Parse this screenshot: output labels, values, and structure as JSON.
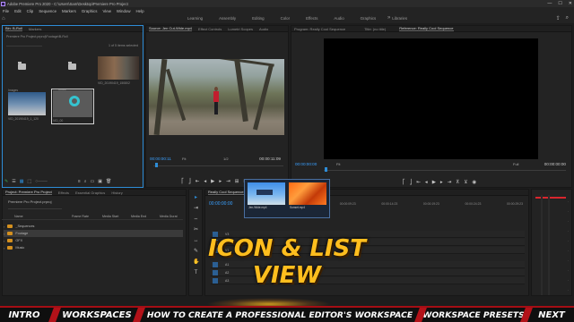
{
  "window": {
    "title": "Adobe Premiere Pro 2020 - C:\\Users\\Sam\\Desktop\\Premiere Pro Project",
    "controls": [
      "—",
      "☐",
      "✕"
    ]
  },
  "menubar": [
    "File",
    "Edit",
    "Clip",
    "Sequence",
    "Markers",
    "Graphics",
    "View",
    "Window",
    "Help"
  ],
  "workspaces": {
    "tabs": [
      "Learning",
      "Assembly",
      "Editing",
      "Color",
      "Effects",
      "Audio",
      "Graphics",
      "Libraries"
    ],
    "more": "»"
  },
  "bin_panel": {
    "tabs": [
      "Bin: B-Roll",
      "Markers"
    ],
    "path": "Premiere Pro Project.prproj\\Footage\\B-Roll",
    "selection": "1 of 5 items selected",
    "search_placeholder": "",
    "items": [
      {
        "caption": "Images",
        "kind": "folder"
      },
      {
        "caption": "Audio",
        "kind": "folder"
      },
      {
        "caption": "VID_20190419_150802",
        "kind": "video"
      },
      {
        "caption": "VID_20190419_1_120",
        "kind": "video"
      },
      {
        "caption": "VID_00",
        "kind": "video"
      }
    ]
  },
  "source_monitor": {
    "tabs": [
      "Source: Jen Cut-Wide.mp4",
      "Effect Controls",
      "Lumetri Scopes",
      "Audio"
    ],
    "timecode_in": "00:00:00:11",
    "timecode_out": "00:00:11:09",
    "fit": "Fit",
    "resolution": "1/2"
  },
  "program_monitor": {
    "tabs": [
      "Program: Really Cool Sequence",
      "Title: (no title)",
      "Reference: Really Cool Sequence"
    ],
    "timecode_in": "00:00:00:00",
    "timecode_out": "00:00:00:00",
    "fit": "Fit",
    "resolution": "Full"
  },
  "project_panel": {
    "tabs": [
      "Project: Premiere Pro Project",
      "Effects",
      "Essential Graphics",
      "History"
    ],
    "project_name": "Premiere Pro Project.prproj",
    "columns": [
      "Name",
      "Frame Rate",
      "Media Start",
      "Media End",
      "Media Durat"
    ],
    "rows": [
      {
        "name": "_Sequences",
        "highlight": false
      },
      {
        "name": "Footage",
        "highlight": true
      },
      {
        "name": "GFX",
        "highlight": false
      },
      {
        "name": "Music",
        "highlight": false
      }
    ]
  },
  "tools": [
    "▸",
    "⇥",
    "⇔",
    "✂",
    "↔",
    "✎",
    "✋",
    "T"
  ],
  "timeline": {
    "tabs": [
      "Really Cool Sequence"
    ],
    "timecode": "00:00:00:00",
    "ruler": [
      "00:00",
      "00:00:04:23",
      "00:00:09:23",
      "00:00:14:23",
      "00:00:19:23",
      "00:00:24:23",
      "00:00:29:23"
    ],
    "tracks": [
      "V3",
      "V2",
      "V1",
      "A1",
      "A2",
      "A3"
    ],
    "clips": [
      {
        "caption": "Jen-Wide.mp4"
      },
      {
        "caption": "Sunset.mp4"
      }
    ]
  },
  "overlay_title": {
    "line1": "ICON & LIST",
    "line2": "VIEW"
  },
  "chapters": [
    "INTRO",
    "WORKSPACES",
    "HOW TO CREATE A PROFESSIONAL EDITOR'S WORKSPACE",
    "WORKSPACE PRESETS",
    "NEXT"
  ],
  "colors": {
    "accent_blue": "#2d8cd6",
    "overlay_gold": "#ffbe1e",
    "chapter_red": "#b21219"
  }
}
